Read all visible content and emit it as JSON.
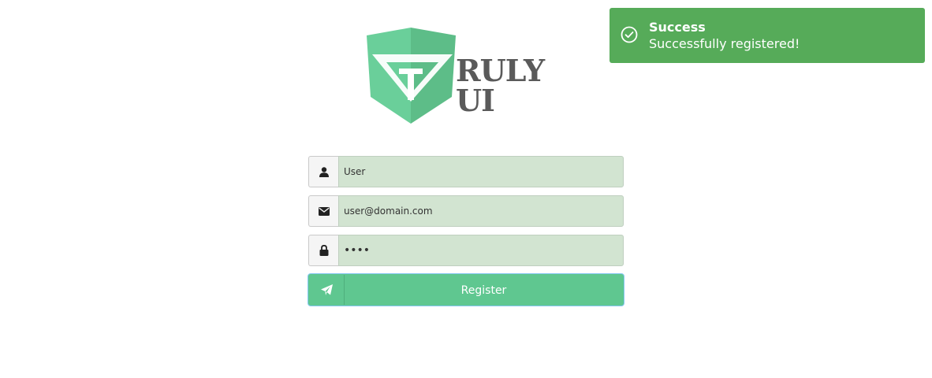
{
  "logo": {
    "text": "RULY UI",
    "icon": "truly-ui-shield-logo",
    "colors": {
      "shield_light": "#6acf9a",
      "shield_dark": "#5dbd88",
      "text": "#5a5a5a"
    }
  },
  "form": {
    "username": {
      "icon": "user-icon",
      "value": "User"
    },
    "email": {
      "icon": "envelope-icon",
      "value": "user@domain.com"
    },
    "password": {
      "icon": "lock-icon",
      "value": "••••"
    },
    "register_button": {
      "icon": "paper-plane-icon",
      "label": "Register"
    },
    "colors": {
      "field_background": "#d2e4d1",
      "button_background": "#5fc790"
    }
  },
  "toast": {
    "icon": "check-circle-icon",
    "title": "Success",
    "message": "Successfully registered!",
    "color": "#56ab59"
  }
}
